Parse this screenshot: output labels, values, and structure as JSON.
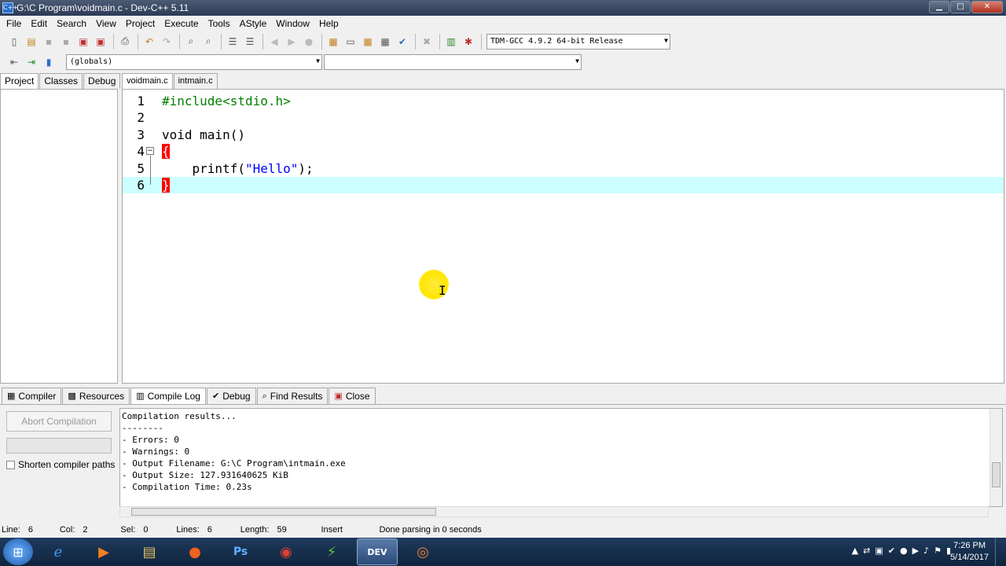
{
  "window": {
    "title": "G:\\C Program\\voidmain.c - Dev-C++ 5.11",
    "app_icon_label": "C++",
    "minimize": "▁",
    "maximize": "□",
    "close": "✕"
  },
  "menu": [
    "File",
    "Edit",
    "Search",
    "View",
    "Project",
    "Execute",
    "Tools",
    "AStyle",
    "Window",
    "Help"
  ],
  "toolbar": {
    "compiler_select": "TDM-GCC 4.9.2 64-bit Release",
    "scope_select": "(globals)",
    "function_select": ""
  },
  "left_tabs": [
    "Project",
    "Classes",
    "Debug"
  ],
  "editor_tabs": [
    "voidmain.c",
    "intmain.c"
  ],
  "code": {
    "line_numbers": [
      "1",
      "2",
      "3",
      "4",
      "5",
      "6"
    ],
    "line1": "#include<stdio.h>",
    "line3": "void main()",
    "line4_brace": "{",
    "line5_indent": "    printf(",
    "line5_string": "\"Hello\"",
    "line5_tail": ");",
    "line6_brace": "}"
  },
  "bottom_tabs": [
    "Compiler",
    "Resources",
    "Compile Log",
    "Debug",
    "Find Results",
    "Close"
  ],
  "bottom_panel": {
    "abort_label": "Abort Compilation",
    "shorten_label": "Shorten compiler paths",
    "log_lines": [
      "Compilation results...",
      "--------",
      "- Errors: 0",
      "- Warnings: 0",
      "- Output Filename: G:\\C Program\\intmain.exe",
      "- Output Size: 127.931640625 KiB",
      "- Compilation Time: 0.23s"
    ]
  },
  "status": {
    "line_label": "Line:",
    "line_value": "6",
    "col_label": "Col:",
    "col_value": "2",
    "sel_label": "Sel:",
    "sel_value": "0",
    "lines_label": "Lines:",
    "lines_value": "6",
    "length_label": "Length:",
    "length_value": "59",
    "mode": "Insert",
    "message": "Done parsing in 0 seconds"
  },
  "taskbar": {
    "time": "7:26 PM",
    "date": "5/14/2017",
    "apps": [
      "ie-icon",
      "media-icon",
      "explorer-icon",
      "firefox-icon",
      "photoshop-icon",
      "chrome-icon",
      "winamp-icon",
      "devcpp-icon",
      "recorder-icon"
    ]
  }
}
